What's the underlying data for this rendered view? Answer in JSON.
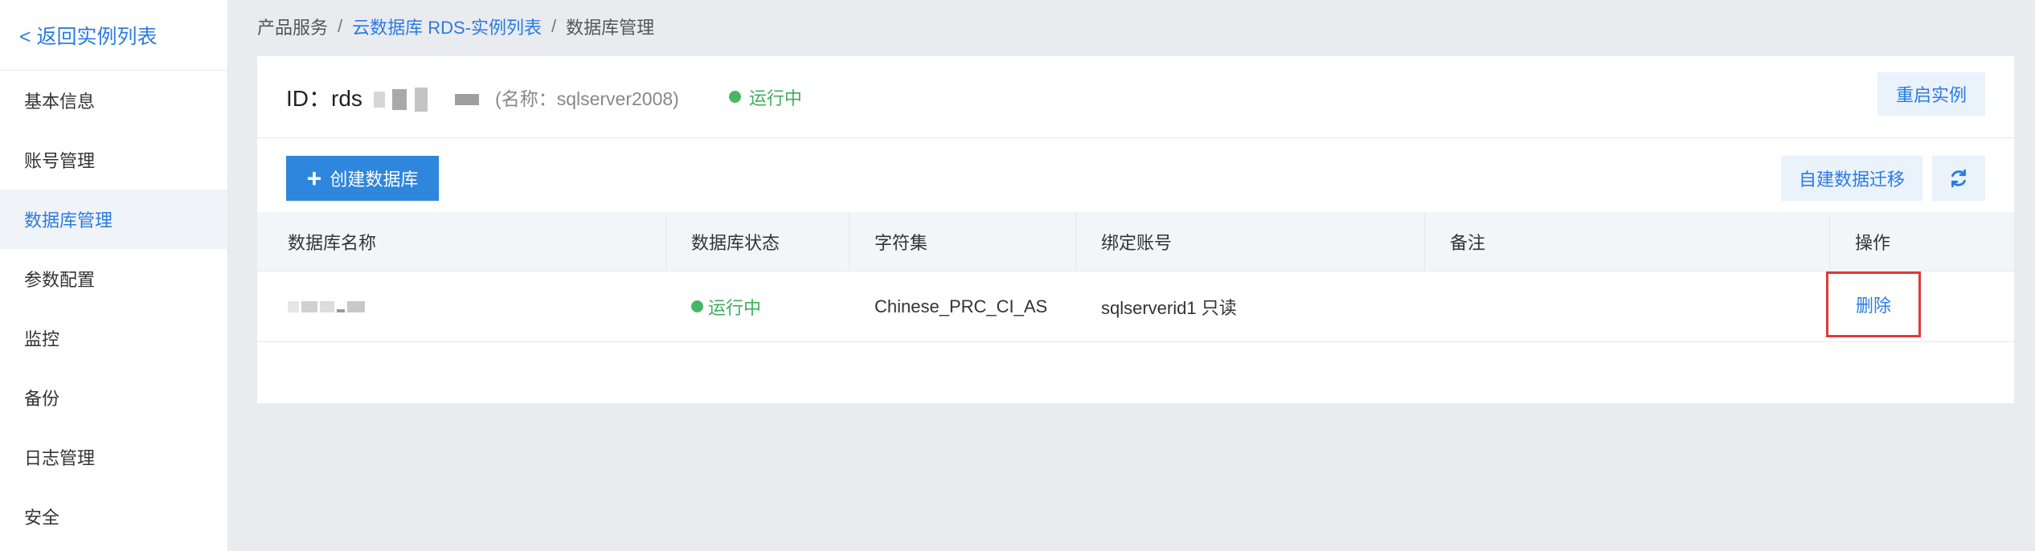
{
  "sidebar": {
    "back_label": "< 返回实例列表",
    "items": [
      {
        "label": "基本信息"
      },
      {
        "label": "账号管理"
      },
      {
        "label": "数据库管理"
      },
      {
        "label": "参数配置"
      },
      {
        "label": "监控"
      },
      {
        "label": "备份"
      },
      {
        "label": "日志管理"
      },
      {
        "label": "安全"
      }
    ],
    "active_item": "数据库管理"
  },
  "breadcrumb": {
    "items": [
      "产品服务",
      "云数据库 RDS-实例列表",
      "数据库管理"
    ],
    "separator": "/"
  },
  "instance": {
    "id_label": "ID：rds",
    "name_label": "(名称：sqlserver2008)",
    "status": "运行中",
    "restart_label": "重启实例"
  },
  "toolbar": {
    "create_label": "创建数据库",
    "migrate_label": "自建数据迁移",
    "refresh_icon": "refresh-icon"
  },
  "table": {
    "columns": [
      "数据库名称",
      "数据库状态",
      "字符集",
      "绑定账号",
      "备注",
      "操作"
    ],
    "rows": [
      {
        "state": "运行中",
        "charset": "Chinese_PRC_CI_AS",
        "account": "sqlserverid1 只读",
        "remark": "",
        "action": "删除"
      }
    ]
  },
  "colors": {
    "accent": "#2b7be0",
    "primary_button": "#2f86dd",
    "status_green": "#47b766",
    "highlight_red": "#e03a3a"
  }
}
